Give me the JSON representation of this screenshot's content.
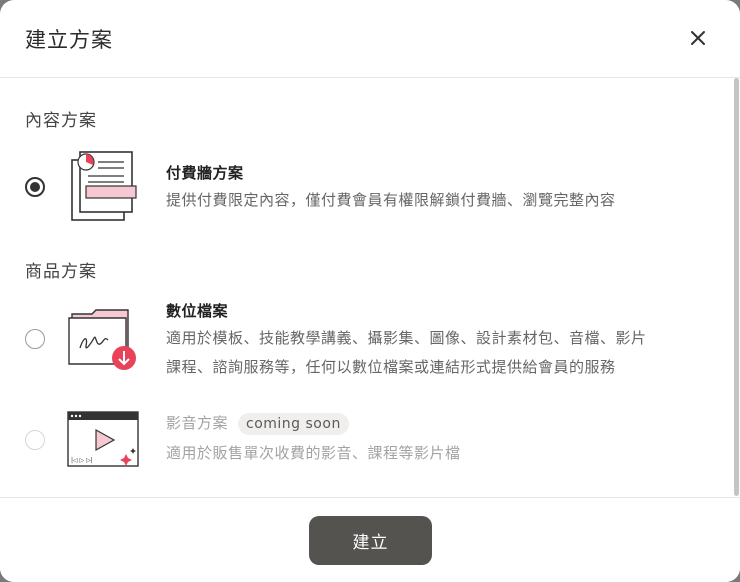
{
  "dialog": {
    "title": "建立方案",
    "close_icon": "close-icon"
  },
  "sections": [
    {
      "label": "內容方案",
      "options": [
        {
          "title": "付費牆方案",
          "description": "提供付費限定內容，僅付費會員有權限解鎖付費牆、瀏覽完整內容",
          "selected": true,
          "disabled": false,
          "icon": "paywall-document-icon"
        }
      ]
    },
    {
      "label": "商品方案",
      "options": [
        {
          "title": "數位檔案",
          "description_line1": "適用於模板、技能教學講義、攝影集、圖像、設計素材包、音檔、影片",
          "description_line2": "課程、諮詢服務等，任何以數位檔案或連結形式提供給會員的服務",
          "selected": false,
          "disabled": false,
          "icon": "digital-file-folder-icon"
        },
        {
          "title": "影音方案",
          "badge": "coming soon",
          "description": "適用於販售單次收費的影音、課程等影片檔",
          "selected": false,
          "disabled": true,
          "icon": "video-player-icon"
        }
      ]
    }
  ],
  "footer": {
    "create_label": "建立"
  },
  "colors": {
    "primary_button": "#555350",
    "accent_pink": "#e8435a",
    "accent_light_pink": "#f6c9d2"
  }
}
